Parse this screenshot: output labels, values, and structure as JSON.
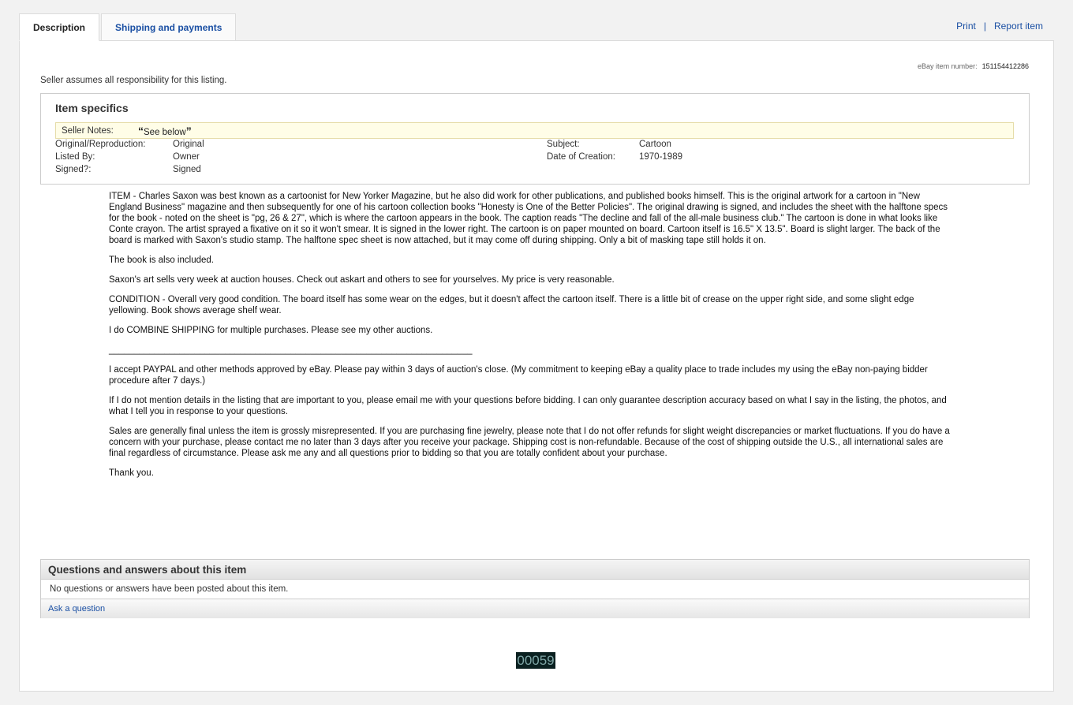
{
  "tabs": [
    {
      "label": "Description"
    },
    {
      "label": "Shipping and payments"
    }
  ],
  "toplinks": {
    "print": "Print",
    "separator": "|",
    "report": "Report item"
  },
  "item_number": {
    "label": "eBay item number:",
    "value": "151154412286"
  },
  "responsibility": "Seller assumes all responsibility for this listing.",
  "specifics": {
    "title": "Item specifics",
    "seller_notes_label": "Seller Notes:",
    "seller_notes_open": "“",
    "seller_notes_value": "See below",
    "seller_notes_close": "”",
    "left": [
      {
        "label": "Original/Reproduction:",
        "value": "Original"
      },
      {
        "label": "Listed By:",
        "value": "Owner"
      },
      {
        "label": "Signed?:",
        "value": "Signed"
      }
    ],
    "right": [
      {
        "label": "Subject:",
        "value": "Cartoon"
      },
      {
        "label": "Date of Creation:",
        "value": "1970-1989"
      }
    ]
  },
  "description": {
    "paragraphs": [
      "ITEM - Charles Saxon was best known as a cartoonist for New Yorker Magazine, but he also did work for other publications, and published books himself.  This is the original artwork for a cartoon in \"New England Business\" magazine and then subsequently for one of his cartoon collection books \"Honesty is One of the Better Policies\".  The original drawing is signed, and includes the sheet with the halftone specs for the book - noted on the sheet is \"pg, 26 & 27\", which is where the cartoon appears in the book.  The caption reads \"The decline and fall of the all-male business club.\"  The cartoon is done in what looks like Conte crayon.  The artist sprayed a fixative on it so it won't smear.  It is signed in the lower right.  The cartoon is on paper mounted on board.  Cartoon itself is 16.5\" X 13.5\".  Board is slight larger.  The back of the board is marked with Saxon's studio stamp.  The halftone spec sheet is now attached, but it may come off during shipping.  Only a bit of masking tape still holds it on.",
      "The book is also included.",
      "Saxon's art sells very week at auction houses. Check out askart and others to see for yourselves.  My price is very reasonable.",
      "CONDITION - Overall very good condition.  The board itself has some wear on the edges, but it doesn't affect the cartoon itself.  There is a little bit of crease on the upper right side, and some slight edge yellowing.  Book shows average shelf wear.",
      "I do COMBINE SHIPPING for multiple purchases.  Please see my other auctions."
    ],
    "rule": "________________________________________________________________________",
    "paragraphs2": [
      "I accept PAYPAL and other methods approved by eBay. Please pay within 3 days of auction's close. (My commitment to keeping eBay a quality place to trade includes my using the eBay non-paying bidder procedure after 7 days.)",
      "If I do not mention details in the listing that are important to you, please email me with your questions before bidding. I can only guarantee description accuracy based on what I say in the listing, the photos, and what I tell you in response to your questions.",
      "Sales are generally final unless the item is grossly misrepresented. If you are purchasing fine jewelry, please note that I do not offer refunds for slight weight discrepancies or market fluctuations. If you do have a concern with your purchase, please contact me no later than 3 days after you receive your package. Shipping cost is non-refundable. Because of the cost of shipping outside the U.S., all international sales are final regardless of circumstance. Please ask me any and all questions prior to bidding so that you are totally confident about your purchase.",
      "Thank you."
    ]
  },
  "qa": {
    "title": "Questions and answers about this item",
    "empty": "No questions or answers have been posted about this item.",
    "ask": "Ask a question"
  },
  "counter": "00059",
  "colors": {
    "link": "#1a4fa3",
    "notes_bg": "#fffde7",
    "counter_bg": "#0a2020"
  }
}
